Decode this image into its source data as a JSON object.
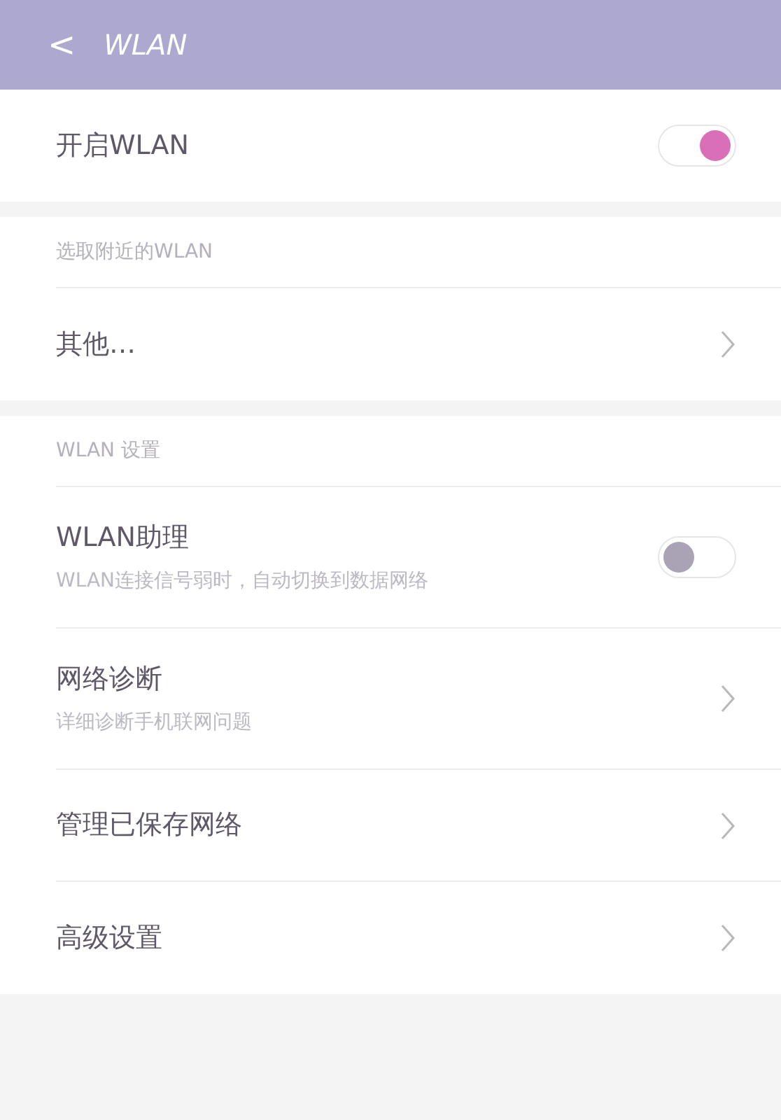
{
  "header": {
    "back": "<",
    "title": "WLAN"
  },
  "sections": [
    {
      "items": [
        {
          "kind": "toggle",
          "label": "开启WLAN",
          "on": true
        }
      ]
    },
    {
      "label": "选取附近的WLAN",
      "items": [
        {
          "kind": "link",
          "label": "其他…"
        }
      ]
    },
    {
      "label": "WLAN 设置",
      "items": [
        {
          "kind": "toggle",
          "label": "WLAN助理",
          "subtitle": "WLAN连接信号弱时，自动切换到数据网络",
          "on": false
        },
        {
          "kind": "link",
          "label": "网络诊断",
          "subtitle": "详细诊断手机联网问题"
        },
        {
          "kind": "link",
          "label": "管理已保存网络"
        },
        {
          "kind": "link",
          "label": "高级设置"
        }
      ]
    }
  ]
}
